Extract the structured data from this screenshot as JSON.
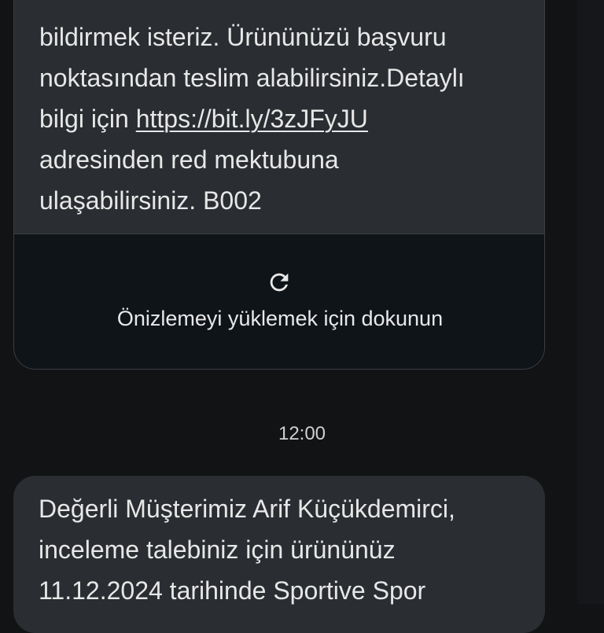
{
  "message_top": {
    "lines": [
      "bildirmek isteriz.  Ürününüzü başvuru",
      "noktasından teslim alabilirsiniz.Detaylı",
      "adresinden red mektubuna",
      "ulaşabilirsiniz. B002"
    ],
    "link_prefix": "bilgi için ",
    "link_text": "https://bit.ly/3zJFyJU"
  },
  "preview": {
    "label": "Önizlemeyi yüklemek için dokunun",
    "icon": "refresh-icon"
  },
  "timestamp": "12:00",
  "message_bottom": {
    "lines": [
      "Değerli Müşterimiz Arif Küçükdemirci,",
      "inceleme talebiniz için ürününüz",
      "11.12.2024 tarihinde Sportive Spor"
    ]
  }
}
